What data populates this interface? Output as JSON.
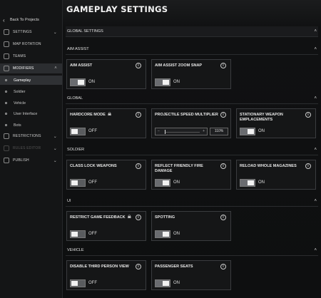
{
  "sidebar": {
    "back_label": "Back To Projects",
    "items": [
      {
        "label": "SETTINGS",
        "icon": "gear-icon"
      },
      {
        "label": "MAP ROTATION",
        "icon": "map-icon"
      },
      {
        "label": "TEAMS",
        "icon": "teams-icon"
      },
      {
        "label": "MODIFIERS",
        "icon": "modifiers-icon"
      },
      {
        "label": "RESTRICTIONS",
        "icon": "restrictions-icon"
      },
      {
        "label": "RULES EDITOR",
        "icon": "rules-icon"
      },
      {
        "label": "PUBLISH",
        "icon": "publish-icon"
      }
    ],
    "sub_items": [
      "Gameplay",
      "Soldier",
      "Vehicle",
      "User Interface",
      "Bots"
    ]
  },
  "page_title": "GAMEPLAY SETTINGS",
  "sections": {
    "global_settings": "GLOBAL SETTINGS",
    "aim_assist": "AIM ASSIST",
    "global": "GLOBAL",
    "soldier": "SOLDIER",
    "ui": "UI",
    "vehicle": "VEHICLE"
  },
  "cards": {
    "aim_assist": {
      "label": "AIM ASSIST",
      "state": "ON"
    },
    "aim_assist_zoom_snap": {
      "label": "AIM ASSIST ZOOM SNAP",
      "state": "ON"
    },
    "hardcore_mode": {
      "label": "HARDCORE MODE",
      "state": "OFF"
    },
    "projectile_speed": {
      "label": "PROJECTILE SPEED MULTIPLIER",
      "value": "110%",
      "minus": "−",
      "plus": "+"
    },
    "stationary_weapon": {
      "label": "STATIONARY WEAPON EMPLACEMENTS",
      "state": "ON"
    },
    "class_lock_weapons": {
      "label": "CLASS LOCK WEAPONS",
      "state": "OFF"
    },
    "reflect_friendly_fire": {
      "label": "REFLECT FRIENDLY FIRE DAMAGE",
      "state": "ON"
    },
    "reload_whole_magazines": {
      "label": "RELOAD WHOLE MAGAZINES",
      "state": "ON"
    },
    "restrict_game_feedback": {
      "label": "RESTRICT GAME FEEDBACK",
      "state": "OFF"
    },
    "spotting": {
      "label": "SPOTTING",
      "state": "ON"
    },
    "disable_third_person": {
      "label": "DISABLE THIRD PERSON VIEW",
      "state": "OFF"
    },
    "passenger_seats": {
      "label": "PASSENGER SEATS",
      "state": "ON"
    }
  },
  "info_glyph": "i",
  "skull_glyph": "☠",
  "caret_glyph": "˄"
}
